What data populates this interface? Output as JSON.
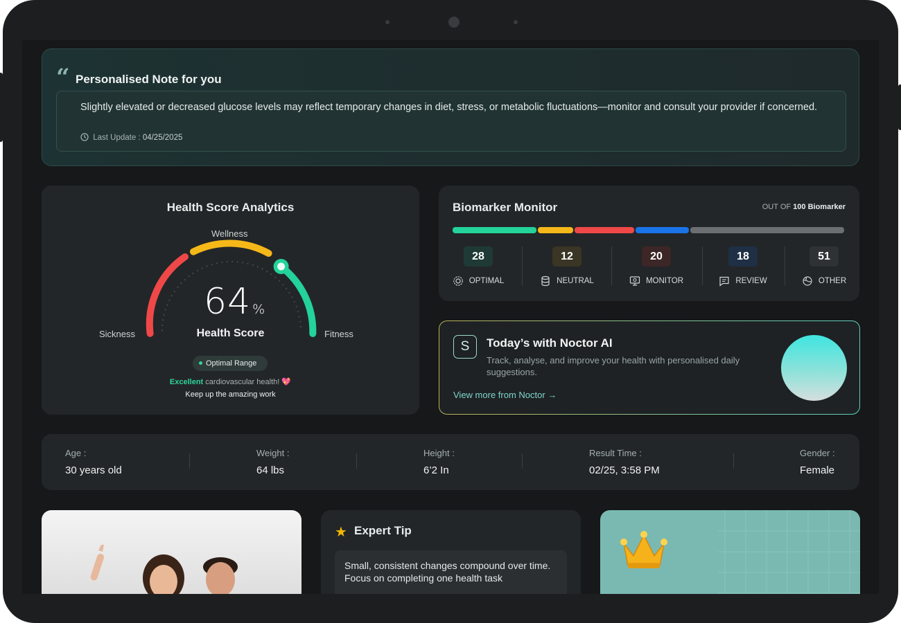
{
  "note": {
    "title": "Personalised Note for you",
    "text": "Slightly elevated or decreased glucose levels may reflect temporary changes in diet, stress, or metabolic fluctuations—monitor and consult your provider if concerned.",
    "update_label": "Last Update :",
    "update_date": "04/25/2025"
  },
  "health": {
    "title": "Health Score Analytics",
    "wellness": "Wellness",
    "sickness": "Sickness",
    "fitness": "Fitness",
    "score": "64",
    "score_fraction": 0.64,
    "unit": "%",
    "score_label": "Health Score",
    "range_pill": "Optimal Range",
    "excellent": "Excellent",
    "excellent_rest": "cardiovascular health!",
    "keep": "Keep up the amazing work"
  },
  "biomarker": {
    "title": "Biomarker Monitor",
    "out_of_prefix": "OUT OF",
    "out_of_value": "100 Biomarker",
    "stats": [
      {
        "value": "28",
        "label": "OPTIMAL",
        "color": "#23d39a",
        "bg": "#1f3a36",
        "icon": "gear-icon"
      },
      {
        "value": "12",
        "label": "NEUTRAL",
        "color": "#f5b818",
        "bg": "#3a3524",
        "icon": "database-icon"
      },
      {
        "value": "20",
        "label": "MONITOR",
        "color": "#f04848",
        "bg": "#3d2626",
        "icon": "monitor-icon"
      },
      {
        "value": "18",
        "label": "REVIEW",
        "color": "#1a73e8",
        "bg": "#1f2f45",
        "icon": "message-icon"
      },
      {
        "value": "51",
        "label": "OTHER",
        "color": "#6c6f72",
        "bg": "#2f3234",
        "icon": "globe-icon"
      }
    ]
  },
  "noctor": {
    "badge": "S",
    "title": "Today’s with Noctor AI",
    "desc": "Track, analyse, and improve your health with personalised daily suggestions.",
    "link": "View more from Noctor"
  },
  "info": [
    {
      "label": "Age :",
      "value": "30 years old"
    },
    {
      "label": "Weight :",
      "value": "64 lbs"
    },
    {
      "label": "Height :",
      "value": "6’2 In"
    },
    {
      "label": "Result Time :",
      "value": "02/25, 3:58 PM"
    },
    {
      "label": "Gender :",
      "value": "Female"
    }
  ],
  "tip": {
    "title": "Expert Tip",
    "text": "Small, consistent changes compound over time. Focus on completing one health task"
  }
}
